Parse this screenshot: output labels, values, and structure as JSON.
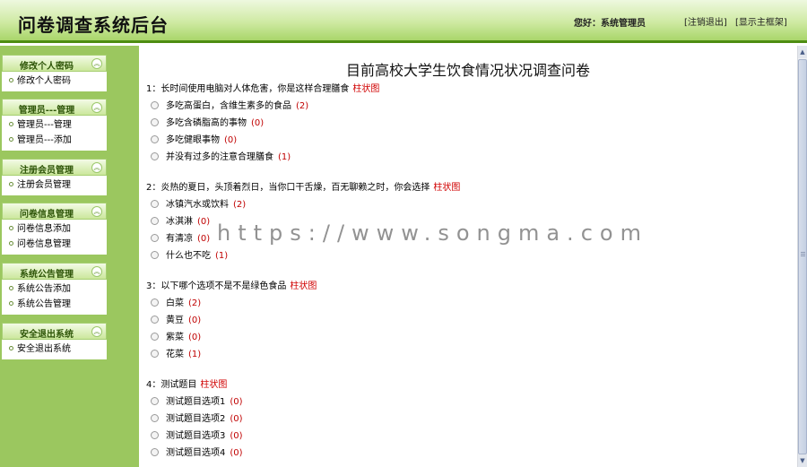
{
  "header": {
    "title": "问卷调查系统后台",
    "greeting": "您好：系统管理员",
    "logout_link": "[注销退出]",
    "main_frame_link": "[显示主框架]"
  },
  "sidebar": {
    "groups": [
      {
        "title": "修改个人密码",
        "items": [
          "修改个人密码"
        ]
      },
      {
        "title": "管理员---管理",
        "items": [
          "管理员---管理",
          "管理员---添加"
        ]
      },
      {
        "title": "注册会员管理",
        "items": [
          "注册会员管理"
        ]
      },
      {
        "title": "问卷信息管理",
        "items": [
          "问卷信息添加",
          "问卷信息管理"
        ]
      },
      {
        "title": "系统公告管理",
        "items": [
          "系统公告添加",
          "系统公告管理"
        ]
      },
      {
        "title": "安全退出系统",
        "items": [
          "安全退出系统"
        ]
      }
    ]
  },
  "main": {
    "page_title": "目前高校大学生饮食情况状况调查问卷",
    "chart_link_label": "柱状图",
    "questions": [
      {
        "title": "1：长时间使用电脑对人体危害，你是这样合理膳食",
        "options": [
          {
            "label": "多吃高蛋白，含维生素多的食品",
            "count": "(2)"
          },
          {
            "label": "多吃含磷脂高的事物",
            "count": "(0)"
          },
          {
            "label": "多吃健眼事物",
            "count": "(0)"
          },
          {
            "label": "并没有过多的注意合理膳食",
            "count": "(1)"
          }
        ]
      },
      {
        "title": "2：炎热的夏日，头顶着烈日，当你口干舌燥，百无聊赖之时，你会选择",
        "options": [
          {
            "label": "冰镇汽水或饮料",
            "count": "(2)"
          },
          {
            "label": "冰淇淋",
            "count": "(0)"
          },
          {
            "label": "有清凉",
            "count": "(0)"
          },
          {
            "label": "什么也不吃",
            "count": "(1)"
          }
        ]
      },
      {
        "title": "3：以下哪个选项不是不是绿色食品",
        "options": [
          {
            "label": "白菜",
            "count": "(2)"
          },
          {
            "label": "黄豆",
            "count": "(0)"
          },
          {
            "label": "紫菜",
            "count": "(0)"
          },
          {
            "label": "花菜",
            "count": "(1)"
          }
        ]
      },
      {
        "title": "4：测试题目",
        "options": [
          {
            "label": "测试题目选项1",
            "count": "(0)"
          },
          {
            "label": "测试题目选项2",
            "count": "(0)"
          },
          {
            "label": "测试题目选项3",
            "count": "(0)"
          },
          {
            "label": "测试题目选项4",
            "count": "(0)"
          }
        ]
      }
    ]
  },
  "watermark": "https://www.songma.com",
  "icons": {
    "collapse": "collapse-chevron-icon",
    "bullet": "bullet-dot-icon",
    "radio": "radio-button"
  },
  "colors": {
    "header_border": "#4e8d12",
    "sidebar_bg": "#9bc75f",
    "chart_link": "#d00000",
    "count": "#c00000"
  }
}
